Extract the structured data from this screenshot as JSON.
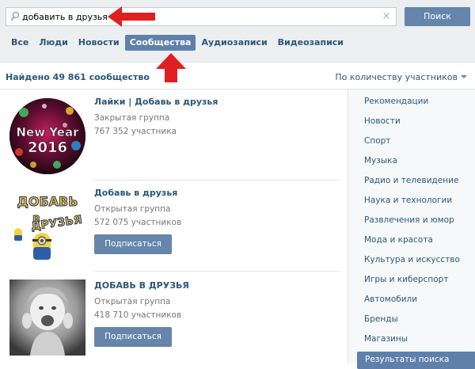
{
  "search": {
    "query": "добавить в друзья",
    "button_label": "Поиск",
    "clear_icon": "×"
  },
  "tabs": [
    {
      "label": "Все",
      "active": false
    },
    {
      "label": "Люди",
      "active": false
    },
    {
      "label": "Новости",
      "active": false
    },
    {
      "label": "Сообщества",
      "active": true
    },
    {
      "label": "Аудиозаписи",
      "active": false
    },
    {
      "label": "Видеозаписи",
      "active": false
    }
  ],
  "results_header": {
    "found": "Найдено 49 861 сообщество",
    "sort": "По количеству участников"
  },
  "groups": [
    {
      "name": "Лайки | Добавь в друзья",
      "type": "Закрытая группа",
      "members": "767 352 участника",
      "avatar_text": "New Year 2016",
      "button": ""
    },
    {
      "name": "Добавь в друзья",
      "type": "Открытая группа",
      "members": "572 075 участников",
      "avatar_text": "ДОБАВЬ В ДРУЗЬЯ",
      "button": "Подписаться"
    },
    {
      "name": "ДОБАВЬ В ДРУЗЬЯ",
      "type": "Открытая группа",
      "members": "418 710 участников",
      "avatar_text": "",
      "button": "Подписаться"
    }
  ],
  "sidebar": {
    "categories": [
      "Рекомендации",
      "Новости",
      "Спорт",
      "Музыка",
      "Радио и телевидение",
      "Наука и технологии",
      "Развлечения и юмор",
      "Мода и красота",
      "Культура и искусство",
      "Игры и киберспорт",
      "Автомобили",
      "Бренды",
      "Магазины"
    ],
    "active": "Результаты поиска"
  },
  "colors": {
    "accent": "#5e80aa",
    "link": "#2b587a",
    "annotation_arrow": "#e02020"
  }
}
